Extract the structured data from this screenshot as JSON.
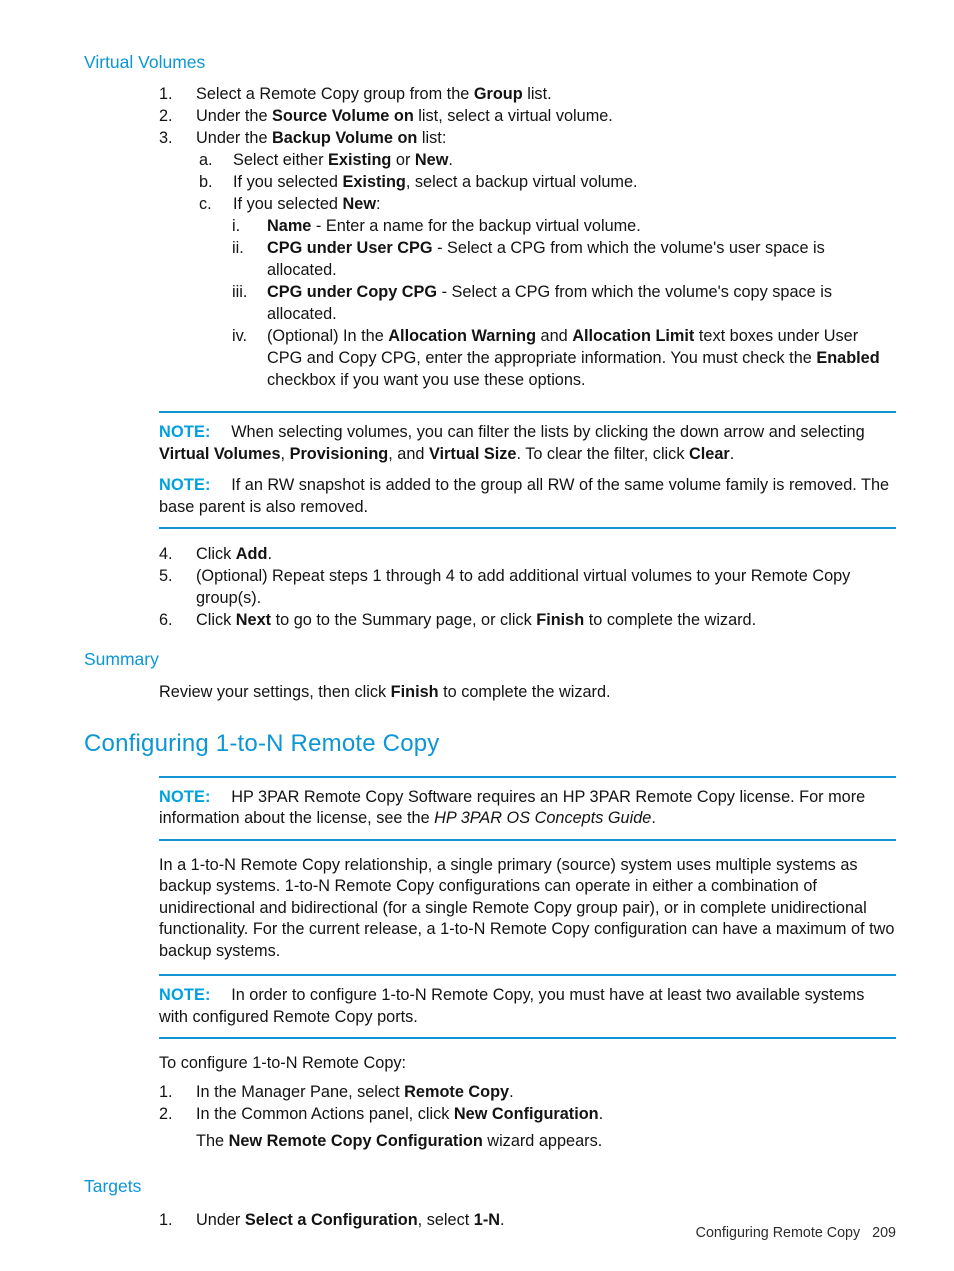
{
  "document": {
    "footer_title": "Configuring Remote Copy",
    "page_number": "209",
    "accent_color": "#0d96d6",
    "note_accent_color": "#00a0df"
  },
  "sections": {
    "virtual_volumes": {
      "heading": "Virtual Volumes",
      "steps": [
        {
          "marker": "1.",
          "text_html": "Select a Remote Copy group from the <b>Group</b> list."
        },
        {
          "marker": "2.",
          "text_html": "Under the <b>Source Volume on</b> list, select a virtual volume."
        },
        {
          "marker": "3.",
          "text_html": "Under the <b>Backup Volume on</b> list:"
        }
      ],
      "substeps": [
        {
          "marker": "a.",
          "text_html": "Select either <b>Existing</b> or <b>New</b>."
        },
        {
          "marker": "b.",
          "text_html": "If you selected <b>Existing</b>, select a backup virtual volume."
        },
        {
          "marker": "c.",
          "text_html": "If you selected <b>New</b>:"
        }
      ],
      "subsubsteps": [
        {
          "marker": "i.",
          "text_html": "<b>Name</b> - Enter a name for the backup virtual volume."
        },
        {
          "marker": "ii.",
          "text_html": "<b>CPG under User CPG</b> - Select a CPG from which the volume's user space is allocated."
        },
        {
          "marker": "iii.",
          "text_html": "<b>CPG under Copy CPG</b> - Select a CPG from which the volume's copy space is allocated."
        },
        {
          "marker": "iv.",
          "text_html": "(Optional) In the <b>Allocation Warning</b> and <b>Allocation Limit</b> text boxes under User CPG and Copy CPG, enter the appropriate information. You must check the <b>Enabled</b> checkbox if you want you use these options."
        }
      ],
      "notes": [
        {
          "label": "NOTE:",
          "text_html": "When selecting volumes, you can filter the lists by clicking the down arrow and selecting <b>Virtual Volumes</b>, <b>Provisioning</b>, and <b>Virtual Size</b>. To clear the filter, click <b>Clear</b>."
        },
        {
          "label": "NOTE:",
          "text_html": "If an RW snapshot is added to the group all RW of the same volume family is removed. The base parent is also removed."
        }
      ],
      "steps_after_note": [
        {
          "marker": "4.",
          "text_html": "Click <b>Add</b>."
        },
        {
          "marker": "5.",
          "text_html": "(Optional) Repeat steps 1 through 4 to add additional virtual volumes to your Remote Copy group(s)."
        },
        {
          "marker": "6.",
          "text_html": "Click <b>Next</b> to go to the Summary page, or click <b>Finish</b> to complete the wizard."
        }
      ]
    },
    "summary": {
      "heading": "Summary",
      "paragraph_html": "Review your settings, then click <b>Finish</b> to complete the wizard."
    },
    "configuring_1_to_n": {
      "heading": "Configuring 1-to-N Remote Copy",
      "note_license": {
        "label": "NOTE:",
        "text_html": "HP 3PAR Remote Copy Software requires an HP 3PAR Remote Copy license. For more information about the license, see the <i>HP 3PAR OS Concepts Guide</i>."
      },
      "paragraph_html": "In a 1-to-N Remote Copy relationship, a single primary (source) system uses multiple systems as backup systems. 1-to-N Remote Copy configurations can operate in either a combination of unidirectional and bidirectional (for a single Remote Copy group pair), or in complete unidirectional functionality. For the current release, a 1-to-N Remote Copy configuration can have a maximum of two backup systems.",
      "note_requirements": {
        "label": "NOTE:",
        "text_html": "In order to configure 1-to-N Remote Copy, you must have at least two available systems with configured Remote Copy ports."
      },
      "intro_html": "To configure 1-to-N Remote Copy:",
      "steps": [
        {
          "marker": "1.",
          "text_html": "In the Manager Pane, select <b>Remote Copy</b>."
        },
        {
          "marker": "2.",
          "text_html": "In the Common Actions panel, click <b>New Configuration</b>."
        }
      ],
      "step2_result_html": "The <b>New Remote Copy Configuration</b> wizard appears."
    },
    "targets": {
      "heading": "Targets",
      "steps": [
        {
          "marker": "1.",
          "text_html": "Under <b>Select a Configuration</b>, select <b>1-N</b>."
        }
      ]
    }
  }
}
